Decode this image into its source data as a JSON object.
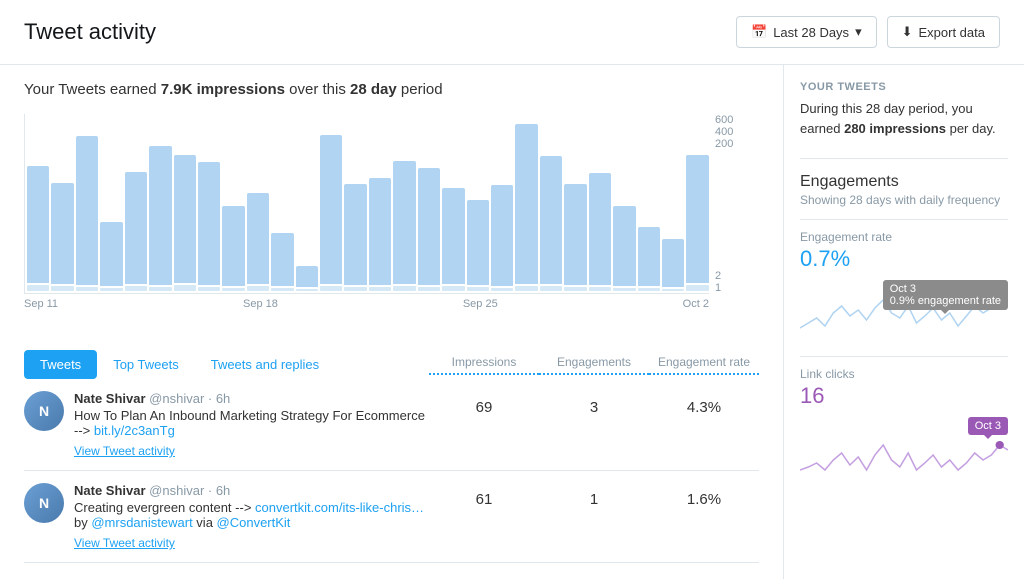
{
  "header": {
    "title": "Tweet activity",
    "date_range_label": "Last 28 Days",
    "export_label": "Export data"
  },
  "summary": {
    "prefix": "Your Tweets earned ",
    "impressions": "7.9K impressions",
    "middle": " over this ",
    "period": "28 day",
    "suffix": " period"
  },
  "chart": {
    "y_axis": [
      "600",
      "400",
      "200",
      "2",
      "1"
    ],
    "x_axis": [
      "Sep 11",
      "Sep 18",
      "Sep 25",
      "Oct 2"
    ],
    "bars": [
      {
        "upper": 110,
        "lower": 6
      },
      {
        "upper": 95,
        "lower": 5
      },
      {
        "upper": 140,
        "lower": 4
      },
      {
        "upper": 60,
        "lower": 3
      },
      {
        "upper": 105,
        "lower": 5
      },
      {
        "upper": 130,
        "lower": 4
      },
      {
        "upper": 120,
        "lower": 6
      },
      {
        "upper": 115,
        "lower": 4
      },
      {
        "upper": 75,
        "lower": 3
      },
      {
        "upper": 85,
        "lower": 5
      },
      {
        "upper": 50,
        "lower": 3
      },
      {
        "upper": 20,
        "lower": 2
      },
      {
        "upper": 140,
        "lower": 5
      },
      {
        "upper": 95,
        "lower": 4
      },
      {
        "upper": 100,
        "lower": 4
      },
      {
        "upper": 115,
        "lower": 5
      },
      {
        "upper": 110,
        "lower": 4
      },
      {
        "upper": 90,
        "lower": 5
      },
      {
        "upper": 80,
        "lower": 4
      },
      {
        "upper": 95,
        "lower": 3
      },
      {
        "upper": 150,
        "lower": 5
      },
      {
        "upper": 120,
        "lower": 5
      },
      {
        "upper": 95,
        "lower": 4
      },
      {
        "upper": 105,
        "lower": 4
      },
      {
        "upper": 75,
        "lower": 3
      },
      {
        "upper": 55,
        "lower": 3
      },
      {
        "upper": 45,
        "lower": 2
      },
      {
        "upper": 120,
        "lower": 6
      }
    ]
  },
  "tabs": [
    {
      "label": "Tweets",
      "active": true
    },
    {
      "label": "Top Tweets",
      "active": false
    },
    {
      "label": "Tweets and replies",
      "active": false
    }
  ],
  "table_headers": {
    "impressions": "Impressions",
    "engagements": "Engagements",
    "engagement_rate": "Engagement rate"
  },
  "tweets": [
    {
      "author": "Nate Shivar",
      "handle": "@nshivar · 6h",
      "content": "How To Plan An Inbound Marketing Strategy For Ecommerce --> ",
      "link_text": "bit.ly/2c3anTg",
      "link_href": "#",
      "impressions": "69",
      "engagements": "3",
      "engagement_rate": "4.3%",
      "view_activity": "View Tweet activity"
    },
    {
      "author": "Nate Shivar",
      "handle": "@nshivar · 6h",
      "content_before_link": "Creating evergreen content --> ",
      "link_text": "convertkit.com/its-like-chris…",
      "link_href": "#",
      "content_after_link": " by ",
      "mention1": "@mrsdanistewart",
      "content_mid": " via ",
      "mention2": "@ConvertKit",
      "impressions": "61",
      "engagements": "1",
      "engagement_rate": "1.6%",
      "view_activity": "View Tweet activity"
    }
  ],
  "sidebar": {
    "your_tweets_title": "YOUR TWEETS",
    "your_tweets_desc_prefix": "During this 28 day period, you earned ",
    "your_tweets_highlight": "280 impressions",
    "your_tweets_desc_suffix": " per day.",
    "engagements_title": "Engagements",
    "engagements_subtitle": "Showing 28 days with daily frequency",
    "engagement_rate_label": "Engagement rate",
    "engagement_rate_value": "0.7%",
    "engagement_tooltip": "0.9% engagement rate",
    "engagement_tooltip_date": "Oct 3",
    "link_clicks_label": "Link clicks",
    "link_clicks_value": "16",
    "link_clicks_tooltip_date": "Oct 3"
  }
}
